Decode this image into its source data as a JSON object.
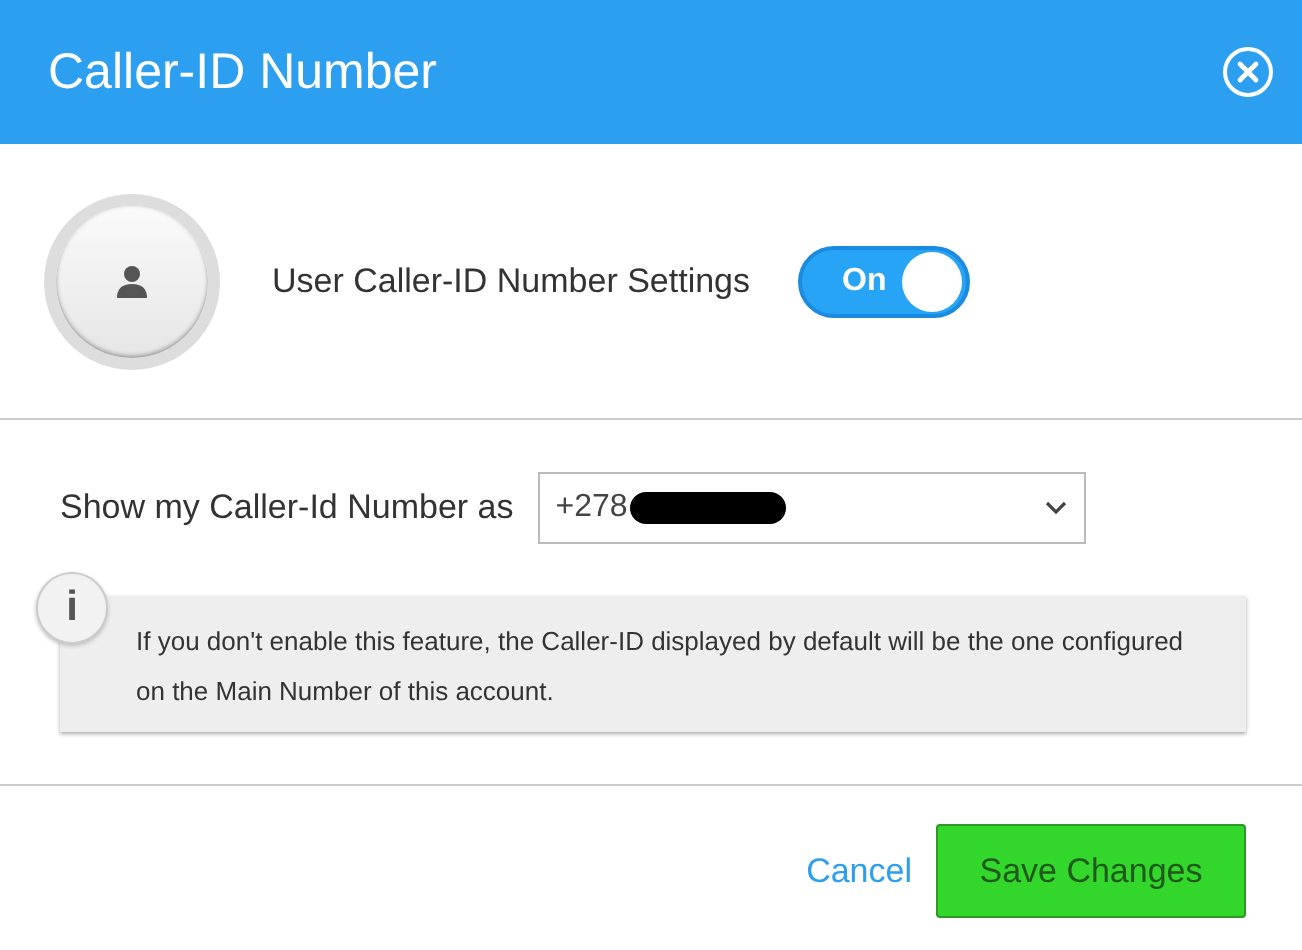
{
  "window": {
    "title": "Caller-ID Number"
  },
  "setting": {
    "label": "User Caller-ID Number Settings",
    "toggle": {
      "on": true,
      "label": "On"
    }
  },
  "number_field": {
    "label": "Show my Caller-Id Number as",
    "value": "+278",
    "redacted": true
  },
  "info": {
    "icon_text": "i",
    "text": "If you don't enable this feature, the Caller-ID displayed by default will be the one configured on the Main Number of this account."
  },
  "buttons": {
    "cancel": "Cancel",
    "save": "Save Changes"
  }
}
